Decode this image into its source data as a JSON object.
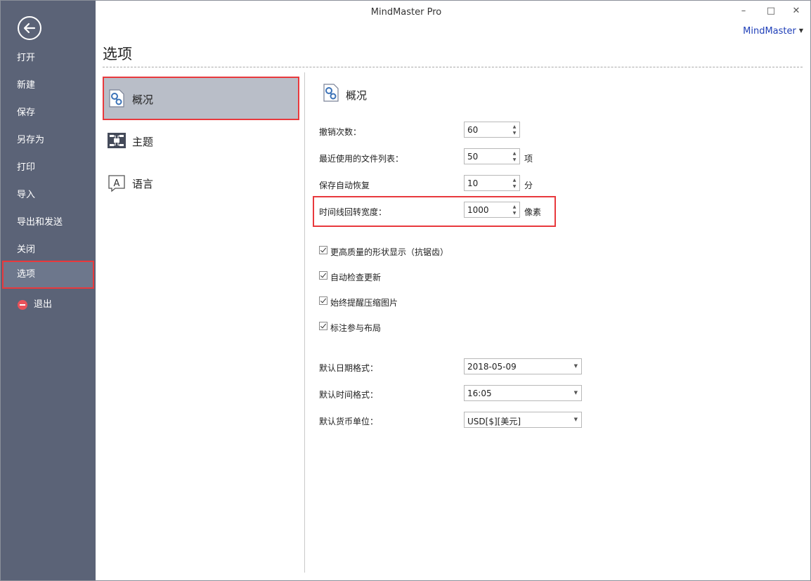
{
  "window": {
    "title": "MindMaster Pro",
    "minimize": "–",
    "maximize": "□",
    "close": "✕",
    "account": "MindMaster"
  },
  "sidebar": {
    "items": [
      {
        "label": "打开"
      },
      {
        "label": "新建"
      },
      {
        "label": "保存"
      },
      {
        "label": "另存为"
      },
      {
        "label": "打印"
      },
      {
        "label": "导入"
      },
      {
        "label": "导出和发送"
      },
      {
        "label": "关闭"
      },
      {
        "label": "选项"
      },
      {
        "label": "退出"
      }
    ],
    "active": "选项"
  },
  "page": {
    "title": "选项"
  },
  "categories": [
    {
      "label": "概况",
      "icon": "general-settings-icon"
    },
    {
      "label": "主题",
      "icon": "theme-icon"
    },
    {
      "label": "语言",
      "icon": "language-icon"
    }
  ],
  "panel": {
    "title": "概况",
    "undo": {
      "label": "撤销次数：",
      "value": "60"
    },
    "recent": {
      "label": "最近使用的文件列表：",
      "value": "50",
      "unit": "项"
    },
    "autosave": {
      "label": "保存自动恢复",
      "value": "10",
      "unit": "分"
    },
    "timeline": {
      "label": "时间线回转宽度：",
      "value": "1000",
      "unit": "像素"
    },
    "checkboxes": [
      {
        "label": "更高质量的形状显示（抗锯齿）",
        "checked": true
      },
      {
        "label": "自动检查更新",
        "checked": true
      },
      {
        "label": "始终提醒压缩图片",
        "checked": true
      },
      {
        "label": "标注参与布局",
        "checked": true
      }
    ],
    "date_format": {
      "label": "默认日期格式：",
      "value": "2018-05-09"
    },
    "time_format": {
      "label": "默认时间格式：",
      "value": "16:05"
    },
    "currency": {
      "label": "默认货币单位：",
      "value": "USD[$][美元]"
    }
  },
  "colors": {
    "sidebar": "#5b6377",
    "highlight": "#e8393d",
    "account_link": "#1f3fb8",
    "exit_icon": "#e9525a"
  }
}
